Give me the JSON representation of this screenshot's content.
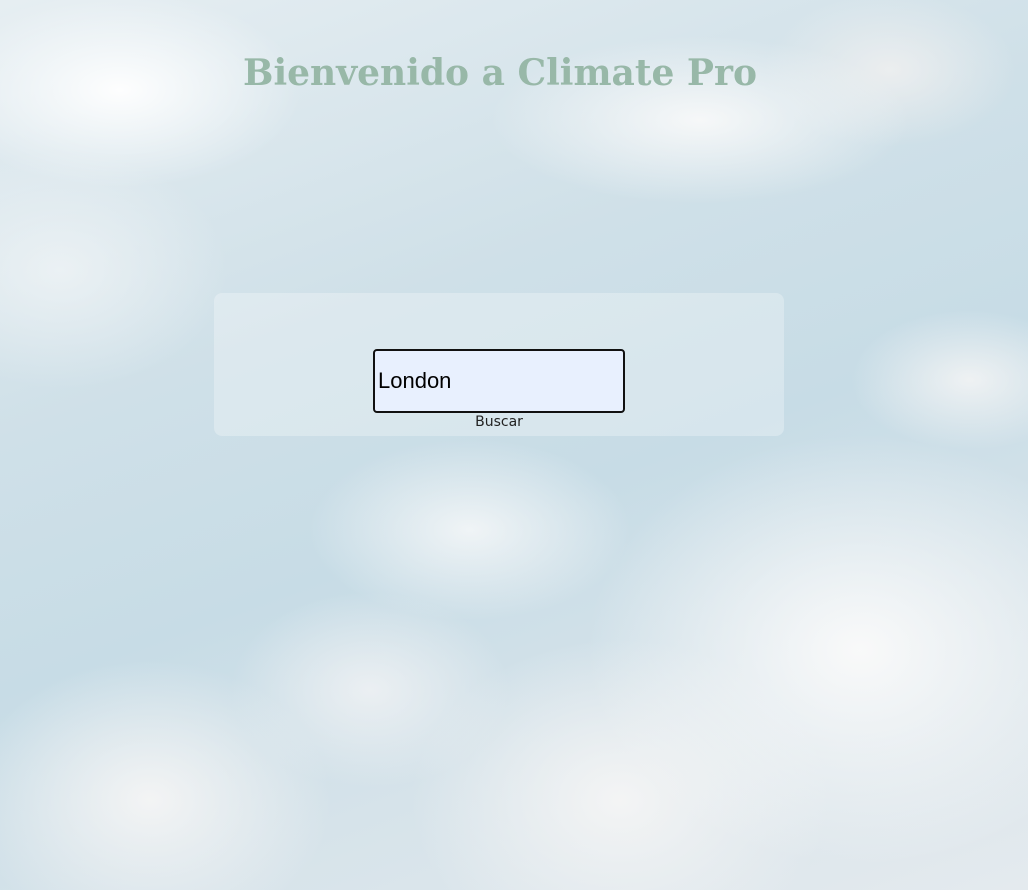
{
  "header": {
    "title": "Bienvenido a Climate Pro"
  },
  "search": {
    "value": "London",
    "placeholder": "",
    "button_label": "Buscar"
  },
  "colors": {
    "title": "#98b8a8",
    "input_background": "#e8f0fe",
    "input_border": "#111111"
  }
}
